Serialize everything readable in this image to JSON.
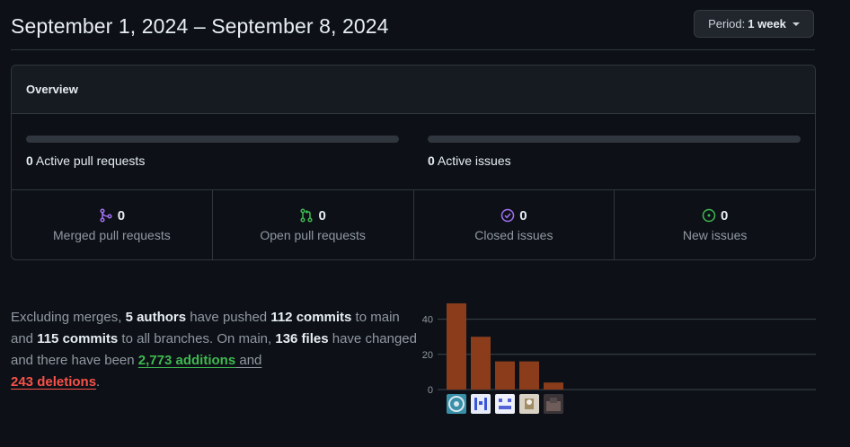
{
  "header": {
    "title": "September 1, 2024 – September 8, 2024",
    "period_label": "Period:",
    "period_value": "1 week"
  },
  "overview": {
    "heading": "Overview",
    "pull_requests": {
      "count": "0",
      "label": "Active pull requests",
      "progress": 0
    },
    "issues": {
      "count": "0",
      "label": "Active issues",
      "progress": 0
    },
    "stats": [
      {
        "count": "0",
        "label": "Merged pull requests",
        "icon": "git-merge-icon",
        "color": "#a371f7"
      },
      {
        "count": "0",
        "label": "Open pull requests",
        "icon": "git-pull-request-icon",
        "color": "#3fb950"
      },
      {
        "count": "0",
        "label": "Closed issues",
        "icon": "issue-closed-icon",
        "color": "#a371f7"
      },
      {
        "count": "0",
        "label": "New issues",
        "icon": "issue-opened-icon",
        "color": "#3fb950"
      }
    ]
  },
  "summary": {
    "t1": "Excluding merges, ",
    "authors": "5 authors",
    "t2": " have pushed ",
    "commits_main": "112 commits",
    "t3": " to main and ",
    "commits_all": "115 commits",
    "t4": " to all branches. On main, ",
    "files": "136 files",
    "t5": " have changed and there have been ",
    "additions_count": "2,773",
    "additions_word": " additions",
    "t6": " and",
    "deletions_count": "243",
    "deletions_word": " deletions",
    "t7": "."
  },
  "chart_data": {
    "type": "bar",
    "categories": [
      "author-1",
      "author-2",
      "author-3",
      "author-4",
      "author-5"
    ],
    "values": [
      49,
      30,
      16,
      16,
      4
    ],
    "ylim": [
      0,
      50
    ],
    "yticks": [
      "0",
      "20",
      "40"
    ],
    "bar_color": "#8b3d1b",
    "grid": true
  },
  "avatars": [
    {
      "name": "avatar-1",
      "bg": "#3a8fa8",
      "fg": "#d8e8f0"
    },
    {
      "name": "avatar-2",
      "bg": "#e8ecf8",
      "fg": "#3b55d9"
    },
    {
      "name": "avatar-3",
      "bg": "#eef0fa",
      "fg": "#5563d9"
    },
    {
      "name": "avatar-4",
      "bg": "#d9d2c4",
      "fg": "#8a6d3b"
    },
    {
      "name": "avatar-5",
      "bg": "#3a3438",
      "fg": "#6e5c5a"
    }
  ]
}
